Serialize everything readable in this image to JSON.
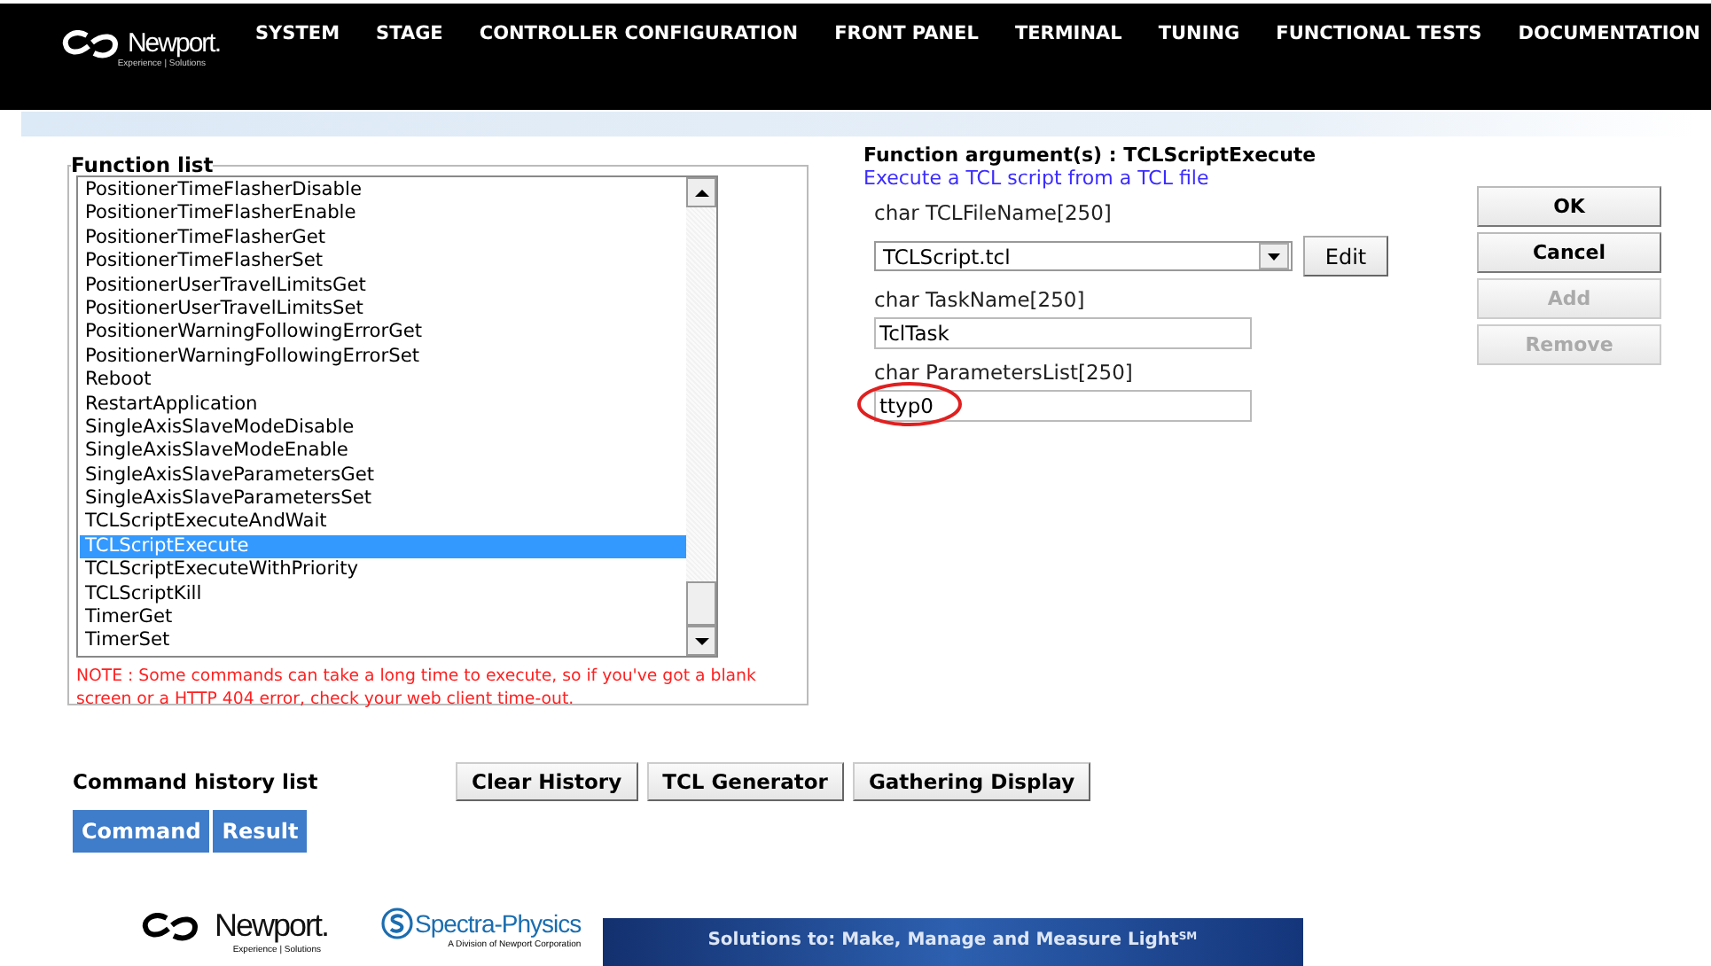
{
  "header": {
    "logo": "Newport.",
    "tagline": "Experience | Solutions",
    "menu": [
      {
        "label": "SYSTEM"
      },
      {
        "label": "STAGE"
      },
      {
        "label": "CONTROLLER CONFIGURATION"
      },
      {
        "label": "FRONT PANEL"
      },
      {
        "label": "TERMINAL"
      },
      {
        "label": "TUNING"
      },
      {
        "label": "FUNCTIONAL TESTS"
      },
      {
        "label": "DOCUMENTATION"
      }
    ]
  },
  "function_list": {
    "title": "Function list",
    "items": [
      {
        "label": "PositionerTimeFlasherDisable",
        "selected": false
      },
      {
        "label": "PositionerTimeFlasherEnable",
        "selected": false
      },
      {
        "label": "PositionerTimeFlasherGet",
        "selected": false
      },
      {
        "label": "PositionerTimeFlasherSet",
        "selected": false
      },
      {
        "label": "PositionerUserTravelLimitsGet",
        "selected": false
      },
      {
        "label": "PositionerUserTravelLimitsSet",
        "selected": false
      },
      {
        "label": "PositionerWarningFollowingErrorGet",
        "selected": false
      },
      {
        "label": "PositionerWarningFollowingErrorSet",
        "selected": false
      },
      {
        "label": "Reboot",
        "selected": false
      },
      {
        "label": "RestartApplication",
        "selected": false
      },
      {
        "label": "SingleAxisSlaveModeDisable",
        "selected": false
      },
      {
        "label": "SingleAxisSlaveModeEnable",
        "selected": false
      },
      {
        "label": "SingleAxisSlaveParametersGet",
        "selected": false
      },
      {
        "label": "SingleAxisSlaveParametersSet",
        "selected": false
      },
      {
        "label": "TCLScriptExecuteAndWait",
        "selected": false
      },
      {
        "label": "TCLScriptExecute",
        "selected": true
      },
      {
        "label": "TCLScriptExecuteWithPriority",
        "selected": false
      },
      {
        "label": "TCLScriptKill",
        "selected": false
      },
      {
        "label": "TimerGet",
        "selected": false
      },
      {
        "label": "TimerSet",
        "selected": false
      }
    ],
    "note": "NOTE : Some commands can take a long time to execute, so if you've got a blank screen or a HTTP 404 error, check your web client time-out."
  },
  "arguments": {
    "title": "Function argument(s) : TCLScriptExecute",
    "description": "Execute a TCL script from a TCL file",
    "fields": [
      {
        "kind": "dropdown",
        "label": "char TCLFileName[250]",
        "value": "TCLScript.tcl",
        "button": "Edit",
        "circled": false
      },
      {
        "kind": "text",
        "label": "char TaskName[250]",
        "value": "TclTask",
        "circled": false
      },
      {
        "kind": "text",
        "label": "char ParametersList[250]",
        "value": "ttyp0",
        "circled": true
      }
    ]
  },
  "actions": [
    {
      "label": "OK",
      "disabled": false
    },
    {
      "label": "Cancel",
      "disabled": false
    },
    {
      "label": "Add",
      "disabled": true
    },
    {
      "label": "Remove",
      "disabled": true
    }
  ],
  "history": {
    "title": "Command history list",
    "buttons": [
      "Clear History",
      "TCL Generator",
      "Gathering Display"
    ],
    "columns": [
      "Command",
      "Result"
    ]
  },
  "footer": {
    "logo": "Newport.",
    "tagline": "Experience | Solutions",
    "partner": "Spectra-Physics",
    "partner_tagline": "A Division of Newport Corporation",
    "banner": "Solutions to: Make, Manage and Measure Light$^{SM}$"
  }
}
